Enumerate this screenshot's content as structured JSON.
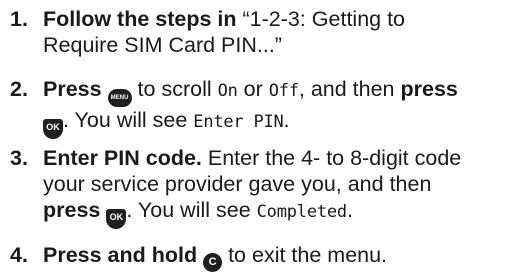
{
  "steps": [
    {
      "number": "1.",
      "lines": [
        {
          "bold": "Follow the steps in",
          "text": " “1-2-3: Getting to"
        },
        {
          "text": "Require SIM Card PIN...”"
        }
      ]
    },
    {
      "number": "2.",
      "line1": {
        "bold_press": "Press",
        "mid1": " to scroll ",
        "lcd_on": "On",
        "or": " or ",
        "lcd_off": "Off",
        "mid2": ", and then ",
        "bold_press2": "press"
      },
      "line2": {
        "mid": ". You will see ",
        "lcd": "Enter PIN",
        "end": "."
      }
    },
    {
      "number": "3.",
      "line1": {
        "bold": "Enter PIN code.",
        "text": " Enter the 4- to 8-digit code"
      },
      "line2": {
        "text": "your service provider gave you, and then"
      },
      "line3": {
        "bold_press": "press",
        "mid": ". You will see ",
        "lcd": "Completed",
        "end": "."
      }
    },
    {
      "number": "4.",
      "line1": {
        "bold": "Press and hold",
        "text": " to exit the menu."
      }
    }
  ],
  "keys": {
    "menu": {
      "label": "MENU",
      "icon": "menu-key-icon"
    },
    "ok": {
      "label": "OK",
      "icon": "ok-key-icon"
    },
    "clear": {
      "label": "C",
      "icon": "clear-key-icon"
    }
  },
  "colors": {
    "text": "#1a1a1a",
    "key": "#1f1f1f"
  }
}
